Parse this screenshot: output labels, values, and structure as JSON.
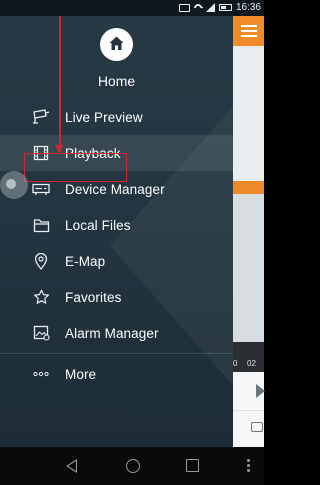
{
  "status_bar": {
    "time": "16:36"
  },
  "drawer": {
    "home_label": "Home",
    "items": [
      {
        "label": "Live Preview",
        "icon": "camera-icon"
      },
      {
        "label": "Playback",
        "icon": "film-icon"
      },
      {
        "label": "Device Manager",
        "icon": "dvr-icon"
      },
      {
        "label": "Local Files",
        "icon": "folder-icon"
      },
      {
        "label": "E-Map",
        "icon": "location-pin-icon"
      },
      {
        "label": "Favorites",
        "icon": "star-icon"
      },
      {
        "label": "Alarm Manager",
        "icon": "alarm-image-icon"
      },
      {
        "label": "More",
        "icon": "more-dots-icon"
      }
    ]
  },
  "background_app": {
    "timeline_label_a": "0",
    "timeline_label_b": "02"
  },
  "colors": {
    "accent": "#f28c28",
    "highlight_box": "#d0262d",
    "drawer_bg": "#22343f"
  }
}
